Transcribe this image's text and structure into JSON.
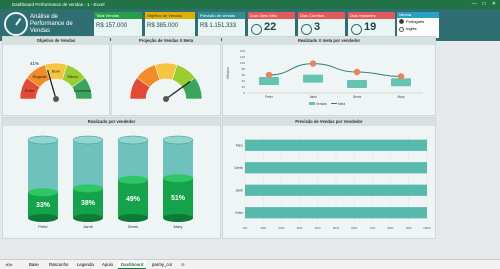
{
  "window": {
    "title": "Dashboard Performance de vendas - 1 - Excel"
  },
  "header": {
    "title": "Análise de Performance de Vendas"
  },
  "kpis": [
    {
      "label": "Total Vendas",
      "value": "R$ 157.000",
      "color": "#24a148"
    },
    {
      "label": "Objetivo de Vendas",
      "value": "R$ 385.000",
      "color": "#e0b000"
    },
    {
      "label": "Previsão de vendas",
      "value": "R$ 1.151.333",
      "color": "#2f8f92"
    },
    {
      "label": "Dias Úteis Mês",
      "value": "22",
      "color": "#e05a5a"
    },
    {
      "label": "Dias Corridos",
      "value": "3",
      "color": "#e05a5a"
    },
    {
      "label": "Dias restantes",
      "value": "19",
      "color": "#e05a5a"
    }
  ],
  "language": {
    "title": "Idioma",
    "options": [
      "Português",
      "Inglês"
    ],
    "selected": "Português"
  },
  "panels": {
    "objetivo": "Objetivo de Vendas",
    "projecao": "Projeção de Vendas X Meta",
    "realizado_meta": "Realizado X meta por vendedor",
    "realizado": "Realizado por vendedor",
    "previsao": "Previsão de Vendas por Vendedor"
  },
  "gauge1": {
    "labels": [
      "Ruim",
      "Regular",
      "Bom",
      "Ótimo",
      "Excelente"
    ],
    "percent_label": "41%",
    "percent": 41
  },
  "gauge2": {
    "percent": 80
  },
  "chart_data": [
    {
      "type": "line",
      "categories": [
        "Peter",
        "Jamb",
        "Derek",
        "Mary"
      ],
      "ylabel": "Milhares",
      "ylim": [
        0,
        140
      ],
      "yticks": [
        "0",
        "20",
        "40",
        "60",
        "80",
        "100",
        "120",
        "140"
      ],
      "series": [
        {
          "name": "Vendas",
          "values": [
            40,
            48,
            30,
            36
          ],
          "color": "#64c4b4"
        },
        {
          "name": "Meta",
          "values": [
            60,
            98,
            70,
            55
          ],
          "color": "#2f7a86"
        }
      ]
    },
    {
      "type": "bar",
      "categories": [
        "Peter",
        "Jamb",
        "Derek",
        "Mary"
      ],
      "values": [
        33,
        38,
        49,
        51
      ],
      "labels": [
        "33%",
        "38%",
        "49%",
        "51%"
      ]
    },
    {
      "type": "bar",
      "orientation": "horizontal",
      "categories": [
        "Mary",
        "Derek",
        "Jamb",
        "Peter"
      ],
      "values": [
        100,
        100,
        100,
        100
      ],
      "xticks": [
        "0%",
        "10%",
        "20%",
        "30%",
        "40%",
        "50%",
        "60%",
        "70%",
        "80%",
        "90%",
        "100%"
      ]
    }
  ],
  "tabs": [
    "Base",
    "Rascunho",
    "Legenda",
    "Apoio",
    "Dashboard",
    "parmy_cor"
  ],
  "active_tab": "Dashboard"
}
